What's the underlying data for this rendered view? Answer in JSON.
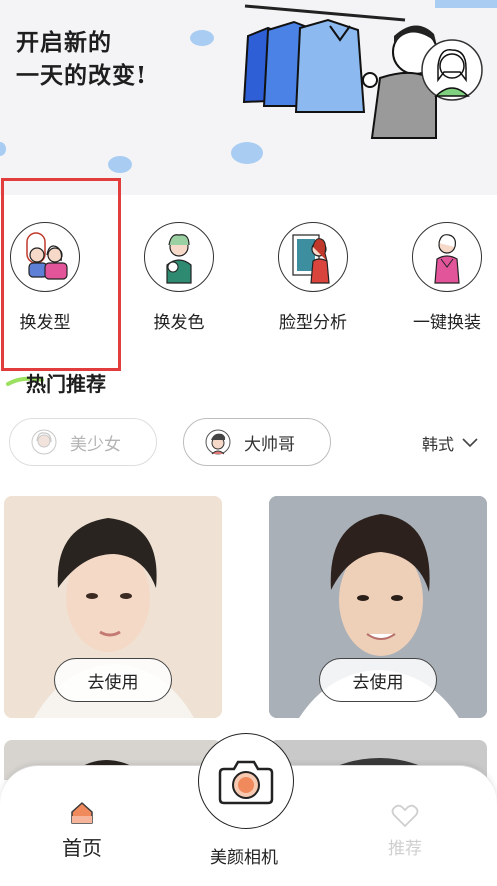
{
  "banner": {
    "title_line1": "开启新的",
    "title_line2": "一天的改变!"
  },
  "features": [
    {
      "label": "换发型",
      "icon": "hairstyle-swap-icon"
    },
    {
      "label": "换发色",
      "icon": "hair-color-icon"
    },
    {
      "label": "脸型分析",
      "icon": "face-shape-analysis-icon"
    },
    {
      "label": "一键换装",
      "icon": "outfit-change-icon"
    }
  ],
  "hot": {
    "title": "热门推荐",
    "chips": [
      {
        "label": "美少女",
        "state": "inactive"
      },
      {
        "label": "大帅哥",
        "state": "active"
      }
    ],
    "style_select": "韩式"
  },
  "cards": [
    {
      "button": "去使用"
    },
    {
      "button": "去使用"
    }
  ],
  "bottom_nav": {
    "home": "首页",
    "camera": "美颜相机",
    "recommend": "推荐"
  },
  "colors": {
    "highlight_box": "#e23d3d",
    "accent_orange": "#f08a5d",
    "banner_blue": "#a9cdf2"
  }
}
